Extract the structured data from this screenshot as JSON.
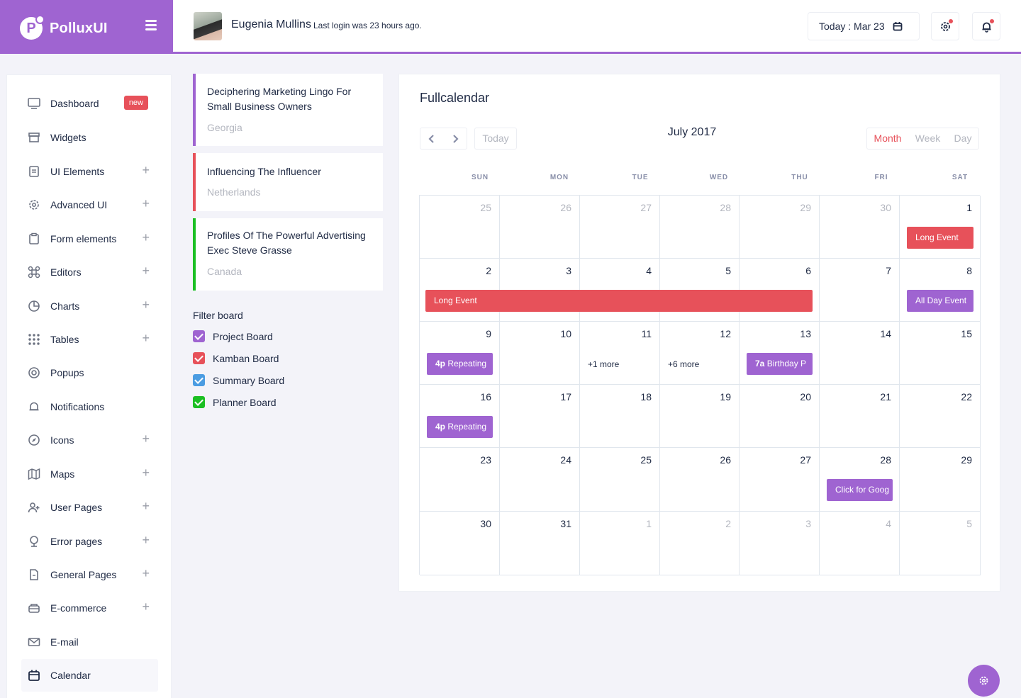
{
  "brand": {
    "name": "PolluxUI",
    "logo_letter": "P"
  },
  "header": {
    "user_name": "Eugenia Mullins",
    "last_login": "Last login was 23 hours ago.",
    "date_label": "Today : Mar 23",
    "icons": [
      "calendar-icon",
      "settings-icon",
      "bell-icon"
    ]
  },
  "sidebar": {
    "items": [
      {
        "label": "Dashboard",
        "icon": "monitor-icon",
        "badge": "new"
      },
      {
        "label": "Widgets",
        "icon": "archive-icon"
      },
      {
        "label": "UI Elements",
        "icon": "document-icon",
        "expand": "+"
      },
      {
        "label": "Advanced UI",
        "icon": "gear-icon",
        "expand": "+"
      },
      {
        "label": "Form elements",
        "icon": "clipboard-icon",
        "expand": "+"
      },
      {
        "label": "Editors",
        "icon": "command-icon",
        "expand": "+"
      },
      {
        "label": "Charts",
        "icon": "pie-chart-icon",
        "expand": "+"
      },
      {
        "label": "Tables",
        "icon": "grid-icon",
        "expand": "+"
      },
      {
        "label": "Popups",
        "icon": "target-icon"
      },
      {
        "label": "Notifications",
        "icon": "bell-icon"
      },
      {
        "label": "Icons",
        "icon": "compass-icon",
        "expand": "+"
      },
      {
        "label": "Maps",
        "icon": "map-icon",
        "expand": "+"
      },
      {
        "label": "User Pages",
        "icon": "user-plus-icon",
        "expand": "+"
      },
      {
        "label": "Error pages",
        "icon": "globe-icon",
        "expand": "+"
      },
      {
        "label": "General Pages",
        "icon": "file-icon",
        "expand": "+"
      },
      {
        "label": "E-commerce",
        "icon": "cart-icon",
        "expand": "+"
      },
      {
        "label": "E-mail",
        "icon": "mail-icon"
      },
      {
        "label": "Calendar",
        "icon": "calendar-icon",
        "active": true
      }
    ]
  },
  "boards": [
    {
      "title": "Deciphering Marketing Lingo For Small Business Owners",
      "location": "Georgia",
      "color": "#9f64d1"
    },
    {
      "title": "Influencing The Influencer",
      "location": "Netherlands",
      "color": "#e7515a"
    },
    {
      "title": "Profiles Of The Powerful Advertising Exec Steve Grasse",
      "location": "Canada",
      "color": "#1bbf23"
    }
  ],
  "filter": {
    "title": "Filter board",
    "items": [
      {
        "label": "Project Board",
        "color": "#9f64d1"
      },
      {
        "label": "Kamban Board",
        "color": "#e7515a"
      },
      {
        "label": "Summary Board",
        "color": "#4b9ce2"
      },
      {
        "label": "Planner Board",
        "color": "#1bbf23"
      }
    ]
  },
  "calendar": {
    "heading": "Fullcalendar",
    "title": "July 2017",
    "today_label": "Today",
    "views": [
      "Month",
      "Week",
      "Day"
    ],
    "active_view": "Month",
    "weekdays": [
      "SUN",
      "MON",
      "TUE",
      "WED",
      "THU",
      "FRI",
      "SAT"
    ],
    "weeks": [
      [
        {
          "d": "25",
          "o": true
        },
        {
          "d": "26",
          "o": true
        },
        {
          "d": "27",
          "o": true
        },
        {
          "d": "28",
          "o": true
        },
        {
          "d": "29",
          "o": true
        },
        {
          "d": "30",
          "o": true
        },
        {
          "d": "1"
        }
      ],
      [
        {
          "d": "2"
        },
        {
          "d": "3"
        },
        {
          "d": "4"
        },
        {
          "d": "5"
        },
        {
          "d": "6"
        },
        {
          "d": "7"
        },
        {
          "d": "8"
        }
      ],
      [
        {
          "d": "9"
        },
        {
          "d": "10"
        },
        {
          "d": "11"
        },
        {
          "d": "12"
        },
        {
          "d": "13"
        },
        {
          "d": "14"
        },
        {
          "d": "15"
        }
      ],
      [
        {
          "d": "16"
        },
        {
          "d": "17"
        },
        {
          "d": "18"
        },
        {
          "d": "19"
        },
        {
          "d": "20"
        },
        {
          "d": "21"
        },
        {
          "d": "22"
        }
      ],
      [
        {
          "d": "23"
        },
        {
          "d": "24"
        },
        {
          "d": "25"
        },
        {
          "d": "26"
        },
        {
          "d": "27"
        },
        {
          "d": "28"
        },
        {
          "d": "29"
        }
      ],
      [
        {
          "d": "30"
        },
        {
          "d": "31"
        },
        {
          "d": "1",
          "o": true
        },
        {
          "d": "2",
          "o": true
        },
        {
          "d": "3",
          "o": true
        },
        {
          "d": "4",
          "o": true
        },
        {
          "d": "5",
          "o": true
        }
      ]
    ],
    "events": [
      {
        "week": 0,
        "start": 6,
        "span": 1,
        "time": "",
        "title": "Long Event",
        "color": "#e7515a"
      },
      {
        "week": 1,
        "start": 0,
        "span": 5,
        "time": "",
        "title": "Long Event",
        "color": "#e7515a"
      },
      {
        "week": 1,
        "start": 6,
        "span": 1,
        "time": "",
        "title": "All Day Event",
        "color": "#9f64d1"
      },
      {
        "week": 2,
        "start": 0,
        "span": 1,
        "time": "4p",
        "title": "Repeating",
        "color": "#9f64d1"
      },
      {
        "week": 2,
        "start": 4,
        "span": 1,
        "time": "7a",
        "title": "Birthday P",
        "color": "#9f64d1"
      },
      {
        "week": 3,
        "start": 0,
        "span": 1,
        "time": "4p",
        "title": "Repeating",
        "color": "#9f64d1"
      },
      {
        "week": 4,
        "start": 5,
        "span": 1,
        "time": "",
        "title": "Click for Goog",
        "color": "#9f64d1"
      }
    ],
    "more_links": [
      {
        "week": 2,
        "day": 2,
        "label": "+1 more"
      },
      {
        "week": 2,
        "day": 3,
        "label": "+6 more"
      }
    ]
  },
  "colors": {
    "accent": "#9f64d1",
    "danger": "#e7515a",
    "success": "#1bbf23",
    "info": "#4b9ce2"
  }
}
